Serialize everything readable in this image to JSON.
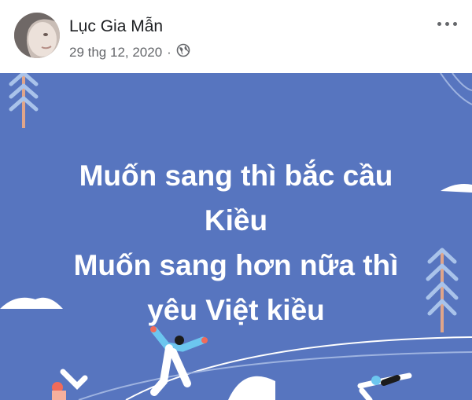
{
  "post": {
    "author_name": "Lục Gia Mẫn",
    "date": "29 thg 12, 2020",
    "separator": "·",
    "privacy_icon": "globe-icon",
    "more_icon": "more-options-icon"
  },
  "banner": {
    "background_color": "#5775bf",
    "lines": [
      "Muốn sang thì bắc cầu",
      "Kiều",
      "Muốn sang hơn nữa thì",
      "yêu Việt kiều"
    ]
  }
}
